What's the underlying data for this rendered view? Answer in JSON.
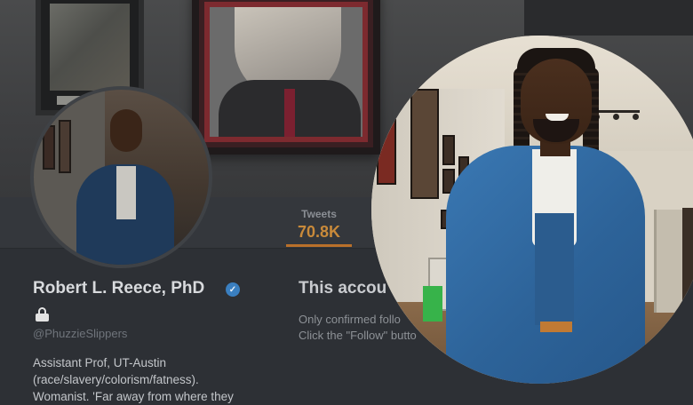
{
  "profile": {
    "display_name": "Robert L. Reece, PhD",
    "handle": "@PhuzzieSlippers",
    "bio_lines": [
      "Assistant Prof, UT-Austin",
      "(race/slavery/colorism/fatness).",
      "Womanist. 'Far away from where they"
    ],
    "verified": true,
    "protected": true
  },
  "nav": {
    "tweets_label": "Tweets",
    "tweets_count": "70.8K"
  },
  "protected_notice": {
    "title": "This accou",
    "line1": "Only confirmed follo",
    "line2": "Click the \"Follow\" butto"
  },
  "icons": {
    "verified": "verified-badge-icon",
    "lock": "lock-icon"
  },
  "colors": {
    "accent_orange": "#c98a3a",
    "verified_blue": "#3a7fc0",
    "background": "#2d3035"
  }
}
